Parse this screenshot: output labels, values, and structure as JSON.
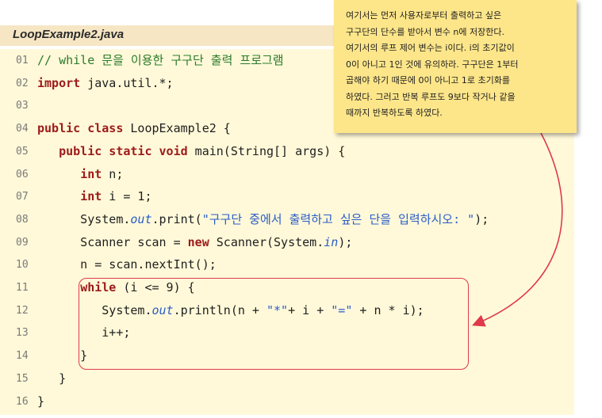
{
  "file_title": "LoopExample2.java",
  "note_lines": [
    "여기서는 먼저 사용자로부터 출력하고 싶은",
    "구구단의 단수를 받아서 변수 n에 저장한다.",
    "여기서의 루프 제어 변수는 i이다. i의 초기값이",
    "0이 아니고 1인 것에 유의하라. 구구단은 1부터",
    "곱해야 하기 때문에 0이 아니고 1로 초기화를",
    "하였다. 그러고 반복 루프도 9보다 작거나 같을",
    "때까지 반복하도록 하였다."
  ],
  "lines": [
    {
      "num": "01",
      "parts": [
        {
          "t": "// while 문을 이용한 구구단 출력 프로그램",
          "c": "cm"
        }
      ]
    },
    {
      "num": "02",
      "parts": [
        {
          "t": "import",
          "c": "kw"
        },
        {
          "t": " java.util.*;",
          "c": ""
        }
      ]
    },
    {
      "num": "03",
      "parts": []
    },
    {
      "num": "04",
      "parts": [
        {
          "t": "public class",
          "c": "kw"
        },
        {
          "t": " LoopExample2 {",
          "c": ""
        }
      ]
    },
    {
      "num": "05",
      "parts": [
        {
          "t": "   ",
          "c": ""
        },
        {
          "t": "public static void",
          "c": "kw"
        },
        {
          "t": " main(String[] args) {",
          "c": ""
        }
      ]
    },
    {
      "num": "06",
      "parts": [
        {
          "t": "      ",
          "c": ""
        },
        {
          "t": "int",
          "c": "kw"
        },
        {
          "t": " n;",
          "c": ""
        }
      ]
    },
    {
      "num": "07",
      "parts": [
        {
          "t": "      ",
          "c": ""
        },
        {
          "t": "int",
          "c": "kw"
        },
        {
          "t": " i = 1;",
          "c": ""
        }
      ]
    },
    {
      "num": "08",
      "parts": [
        {
          "t": "      System.",
          "c": ""
        },
        {
          "t": "out",
          "c": "fld"
        },
        {
          "t": ".print(",
          "c": ""
        },
        {
          "t": "\"구구단 중에서 출력하고 싶은 단을 입력하시오: \"",
          "c": "str"
        },
        {
          "t": ");",
          "c": ""
        }
      ]
    },
    {
      "num": "09",
      "parts": [
        {
          "t": "      Scanner scan = ",
          "c": ""
        },
        {
          "t": "new",
          "c": "kw"
        },
        {
          "t": " Scanner(System.",
          "c": ""
        },
        {
          "t": "in",
          "c": "fld"
        },
        {
          "t": ");",
          "c": ""
        }
      ]
    },
    {
      "num": "10",
      "parts": [
        {
          "t": "      n = scan.nextInt();",
          "c": ""
        }
      ]
    },
    {
      "num": "11",
      "parts": [
        {
          "t": "      ",
          "c": ""
        },
        {
          "t": "while",
          "c": "kw"
        },
        {
          "t": " (i <= 9) {",
          "c": ""
        }
      ]
    },
    {
      "num": "12",
      "parts": [
        {
          "t": "         System.",
          "c": ""
        },
        {
          "t": "out",
          "c": "fld"
        },
        {
          "t": ".println(n + ",
          "c": ""
        },
        {
          "t": "\"*\"",
          "c": "str"
        },
        {
          "t": "+ i + ",
          "c": ""
        },
        {
          "t": "\"=\"",
          "c": "str"
        },
        {
          "t": " + n * i);",
          "c": ""
        }
      ]
    },
    {
      "num": "13",
      "parts": [
        {
          "t": "         i++;",
          "c": ""
        }
      ]
    },
    {
      "num": "14",
      "parts": [
        {
          "t": "      }",
          "c": ""
        }
      ]
    },
    {
      "num": "15",
      "parts": [
        {
          "t": "   }",
          "c": ""
        }
      ]
    },
    {
      "num": "16",
      "parts": [
        {
          "t": "}",
          "c": ""
        }
      ]
    }
  ],
  "colors": {
    "keyword": "#9c1a1a",
    "comment": "#2a7a2a",
    "field": "#2a5cc8",
    "highlight": "#e0394a"
  }
}
